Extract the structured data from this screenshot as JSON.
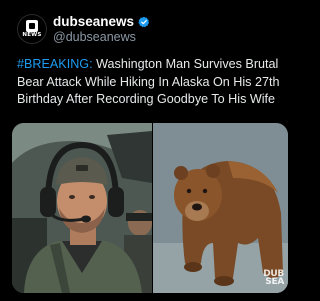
{
  "account": {
    "display_name": "dubseanews",
    "handle": "@dubseanews",
    "avatar_text": "NEWS",
    "verified": true
  },
  "tweet": {
    "hashtag": "#BREAKING:",
    "text": " Washington Man Survives Brutal Bear Attack While Hiking In Alaska On His 27th Birthday After Recording Goodbye To His Wife"
  },
  "media": {
    "left_image": "man-in-aviation-headset-photo",
    "right_image": "brown-bear-photo",
    "watermark_line1": "DUB",
    "watermark_line2": "SEA"
  },
  "colors": {
    "background": "#000000",
    "text": "#e7e9ea",
    "secondary_text": "#8b98a5",
    "hashtag": "#1d9bf0",
    "verified_badge": "#1d9bf0"
  }
}
